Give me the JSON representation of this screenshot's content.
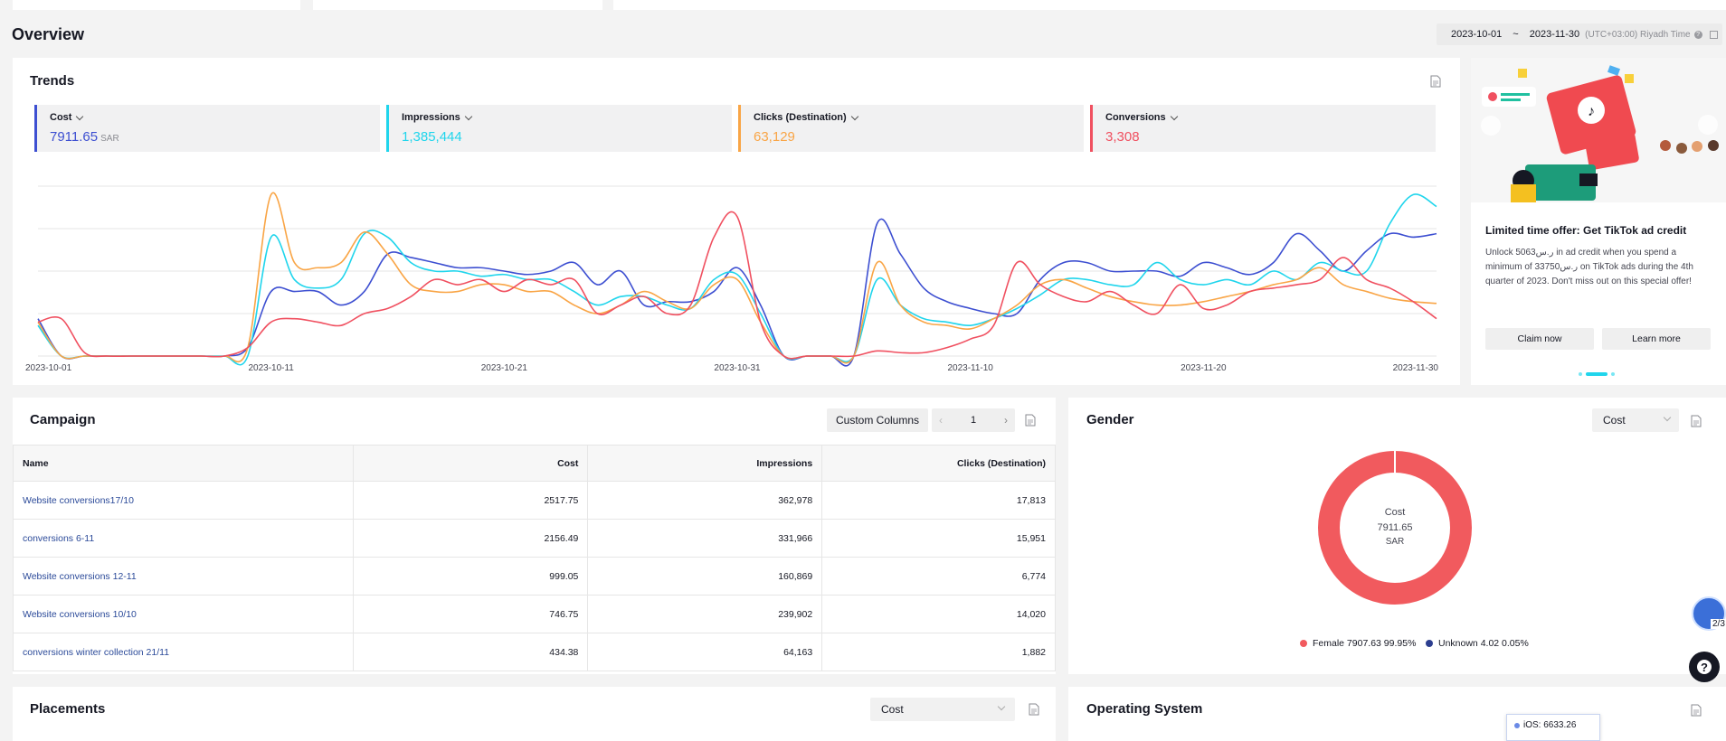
{
  "header": {
    "title": "Overview",
    "date_start": "2023-10-01",
    "date_sep": "~",
    "date_end": "2023-11-30",
    "timezone": "(UTC+03:00) Riyadh Time"
  },
  "trends": {
    "title": "Trends",
    "metrics": [
      {
        "label": "Cost",
        "value": "7911.65",
        "unit": "SAR",
        "color": "#3d4fd1"
      },
      {
        "label": "Impressions",
        "value": "1,385,444",
        "color": "#20d5ec"
      },
      {
        "label": "Clicks (Destination)",
        "value": "63,129",
        "color": "#f9a546"
      },
      {
        "label": "Conversions",
        "value": "3,308",
        "color": "#f05060"
      }
    ]
  },
  "chart_data": {
    "type": "line",
    "x_ticks": [
      "2023-10-01",
      "2023-10-11",
      "2023-10-21",
      "2023-10-31",
      "2023-11-10",
      "2023-11-20",
      "2023-11-30"
    ],
    "x_count": 61,
    "grid": true,
    "series": [
      {
        "name": "Cost",
        "color": "#3d4fd1",
        "values": [
          0.22,
          0,
          0,
          0,
          0,
          0,
          0,
          0,
          0,
          0.05,
          0.38,
          0.38,
          0.38,
          0.3,
          0.38,
          0.6,
          0.58,
          0.55,
          0.52,
          0.52,
          0.5,
          0.48,
          0.5,
          0.55,
          0.42,
          0.5,
          0.3,
          0.32,
          0.32,
          0.38,
          0.52,
          0.3,
          0,
          0,
          0,
          0,
          0.78,
          0.6,
          0.4,
          0.32,
          0.28,
          0.25,
          0.25,
          0.45,
          0.55,
          0.55,
          0.5,
          0.5,
          0.5,
          0.47,
          0.55,
          0.52,
          0.48,
          0.55,
          0.72,
          0.62,
          0.5,
          0.62,
          0.72,
          0.7,
          0.72
        ]
      },
      {
        "name": "Impressions",
        "color": "#20d5ec",
        "values": [
          0.18,
          0,
          0,
          0,
          0,
          0,
          0,
          0,
          0,
          0,
          0.7,
          0.45,
          0.4,
          0.45,
          0.72,
          0.7,
          0.55,
          0.5,
          0.5,
          0.47,
          0.48,
          0.45,
          0.45,
          0.38,
          0.3,
          0.35,
          0.35,
          0.3,
          0.28,
          0.45,
          0.48,
          0.25,
          0,
          0,
          0,
          0,
          0.45,
          0.3,
          0.22,
          0.2,
          0.18,
          0.22,
          0.28,
          0.36,
          0.45,
          0.45,
          0.42,
          0.42,
          0.55,
          0.45,
          0.42,
          0.45,
          0.42,
          0.5,
          0.45,
          0.55,
          0.5,
          0.5,
          0.78,
          0.95,
          0.88
        ]
      },
      {
        "name": "Clicks (Destination)",
        "color": "#f9a546",
        "values": [
          0.2,
          0,
          0,
          0,
          0,
          0,
          0,
          0,
          0,
          0.05,
          0.95,
          0.55,
          0.52,
          0.55,
          0.73,
          0.6,
          0.42,
          0.38,
          0.38,
          0.42,
          0.42,
          0.38,
          0.38,
          0.3,
          0.25,
          0.3,
          0.38,
          0.32,
          0.28,
          0.42,
          0.45,
          0.2,
          0,
          0,
          0,
          0,
          0.55,
          0.3,
          0.2,
          0.18,
          0.16,
          0.22,
          0.3,
          0.42,
          0.45,
          0.4,
          0.35,
          0.32,
          0.3,
          0.3,
          0.32,
          0.35,
          0.38,
          0.42,
          0.45,
          0.52,
          0.42,
          0.38,
          0.34,
          0.32,
          0.31
        ]
      },
      {
        "name": "Conversions",
        "color": "#f05060",
        "values": [
          0.2,
          0.22,
          0.02,
          0,
          0,
          0,
          0,
          0,
          0,
          0.05,
          0.2,
          0.22,
          0.2,
          0.18,
          0.25,
          0.28,
          0.35,
          0.45,
          0.42,
          0.45,
          0.38,
          0.45,
          0.42,
          0.45,
          0.25,
          0.3,
          0.35,
          0.25,
          0.3,
          0.7,
          0.82,
          0.2,
          0,
          0,
          0,
          0,
          0.03,
          0.02,
          0.02,
          0.05,
          0.1,
          0.18,
          0.55,
          0.42,
          0.35,
          0.32,
          0.38,
          0.3,
          0.25,
          0.42,
          0.28,
          0.3,
          0.38,
          0.4,
          0.42,
          0.45,
          0.58,
          0.45,
          0.4,
          0.32,
          0.22
        ]
      }
    ]
  },
  "promo": {
    "title": "Limited time offer: Get TikTok ad credit",
    "description": "Unlock 5063ر.س in ad credit when you spend a minimum of 33750ر.س on TikTok ads during the 4th quarter of 2023. Don't miss out on this special offer!",
    "claim_label": "Claim now",
    "learn_label": "Learn more"
  },
  "campaign": {
    "title": "Campaign",
    "custom_columns_label": "Custom Columns",
    "page": "1",
    "columns": [
      "Name",
      "Cost",
      "Impressions",
      "Clicks (Destination)"
    ],
    "rows": [
      {
        "name": "Website conversions17/10",
        "cost": "2517.75",
        "impressions": "362,978",
        "clicks": "17,813"
      },
      {
        "name": "conversions 6-11",
        "cost": "2156.49",
        "impressions": "331,966",
        "clicks": "15,951"
      },
      {
        "name": "Website conversions 12-11",
        "cost": "999.05",
        "impressions": "160,869",
        "clicks": "6,774"
      },
      {
        "name": "Website conversions 10/10",
        "cost": "746.75",
        "impressions": "239,902",
        "clicks": "14,020"
      },
      {
        "name": "conversions winter collection 21/11",
        "cost": "434.38",
        "impressions": "64,163",
        "clicks": "1,882"
      }
    ]
  },
  "gender": {
    "title": "Gender",
    "select_value": "Cost",
    "center_label": "Cost",
    "center_value": "7911.65",
    "center_unit": "SAR",
    "legend": [
      {
        "label": "Female 7907.63 99.95%",
        "color": "#f15a5e",
        "fraction": 0.9995
      },
      {
        "label": "Unknown 4.02 0.05%",
        "color": "#2c3e8f",
        "fraction": 0.0005
      }
    ]
  },
  "placements": {
    "title": "Placements",
    "select_value": "Cost"
  },
  "operating_system": {
    "title": "Operating System",
    "tooltip": "iOS: 6633.26"
  },
  "floating": {
    "page_counter": "2/3",
    "help": "?"
  }
}
